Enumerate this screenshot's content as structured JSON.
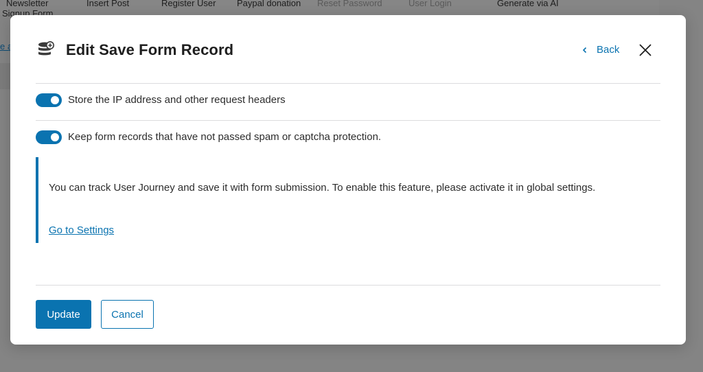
{
  "background": {
    "tabs": [
      {
        "label": "Newsletter",
        "sublabel": "Signup Form"
      },
      {
        "label": "Insert Post"
      },
      {
        "label": "Register User"
      },
      {
        "label": "Paypal donation"
      },
      {
        "label": "Reset Password"
      },
      {
        "label": "User Login"
      },
      {
        "label": "Generate via AI"
      }
    ],
    "link_fragment": "e a"
  },
  "modal": {
    "title": "Edit Save Form Record",
    "title_icon": "database-plus-icon",
    "back_label": "Back",
    "back_icon": "chevron-left-icon",
    "close_icon": "close-icon",
    "toggles": [
      {
        "label": "Store the IP address and other request headers",
        "enabled": true
      },
      {
        "label": "Keep form records that have not passed spam or captcha protection.",
        "enabled": true
      }
    ],
    "notice": {
      "text": "You can track User Journey and save it with form submission. To enable this feature, please activate it in global settings.",
      "link_label": "Go to Settings"
    },
    "update_label": "Update",
    "cancel_label": "Cancel"
  },
  "colors": {
    "accent": "#0a73b0",
    "overlay": "#7a7a7a",
    "divider": "#dcdcde"
  }
}
